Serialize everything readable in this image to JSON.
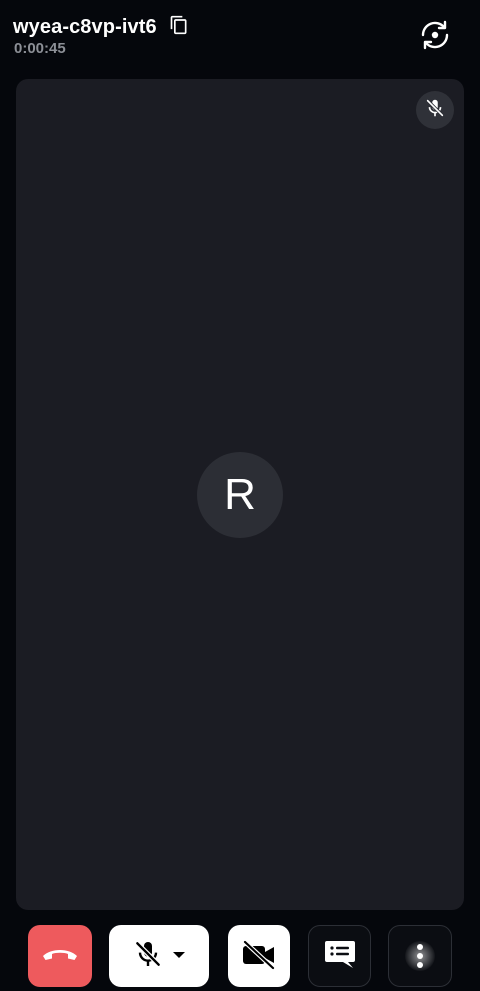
{
  "header": {
    "meeting_code": "wyea-c8vp-ivt6",
    "elapsed_time": "0:00:45",
    "copy_icon": "copy-icon",
    "switch_camera_icon": "switch-camera-icon"
  },
  "participant_tile": {
    "avatar_initial": "R",
    "mic_status_icon": "mic-off-icon",
    "mic_muted": true
  },
  "controls": {
    "hangup_icon": "phone-hangup-icon",
    "mic_icon": "mic-off-icon",
    "mic_dropdown_icon": "caret-down-icon",
    "camera_icon": "camera-off-icon",
    "chat_icon": "chat-icon",
    "more_icon": "more-vertical-icon"
  },
  "colors": {
    "background": "#05070c",
    "tile": "#1b1c23",
    "hangup": "#ee5a5d",
    "timer": "#8c8f96"
  }
}
